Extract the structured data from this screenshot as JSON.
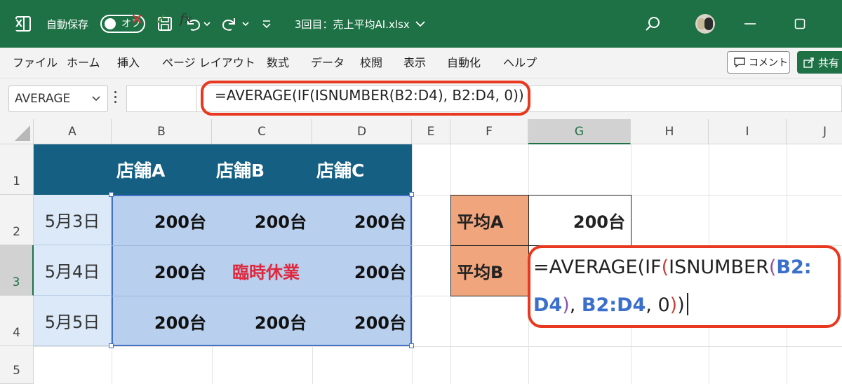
{
  "titlebar": {
    "autosave_label": "自動保存",
    "autosave_state": "オフ",
    "doc_title": "3回目：売上平均AI.xlsx",
    "icons": [
      "excel-logo-icon",
      "save-icon",
      "undo-icon",
      "redo-icon",
      "customize-qat-icon",
      "search-icon",
      "minimize-icon",
      "maximize-icon"
    ],
    "accent_color": "#1e7145"
  },
  "menu": {
    "items": [
      "ファイル",
      "ホーム",
      "挿入",
      "ページ レイアウト",
      "数式",
      "データ",
      "校閲",
      "表示",
      "自動化",
      "ヘルプ"
    ],
    "comment_label": "コメント",
    "share_label": "共有"
  },
  "formula_bar": {
    "name_box": "AVERAGE",
    "fx_label": "fx",
    "formula": "=AVERAGE(IF(ISNUMBER(B2:D4), B2:D4, 0))",
    "highlight_color": "#e8381f"
  },
  "sheet": {
    "columns": [
      "A",
      "B",
      "C",
      "D",
      "E",
      "F",
      "G",
      "H",
      "I",
      "J"
    ],
    "rows": [
      "1",
      "2",
      "3",
      "4",
      "5"
    ],
    "selected_column": "G",
    "selected_row": "3",
    "header_row": [
      "店舗A",
      "店舗B",
      "店舗C"
    ],
    "header_color": "#155f83",
    "data_rows": [
      {
        "date": "5月3日",
        "values": [
          "200台",
          "200台",
          "200台"
        ]
      },
      {
        "date": "5月4日",
        "values": [
          "200台",
          "臨時休業",
          "200台"
        ]
      },
      {
        "date": "5月5日",
        "values": [
          "200台",
          "200台",
          "200台"
        ]
      }
    ],
    "averages": [
      {
        "label": "平均A",
        "value": "200台"
      },
      {
        "label": "平均B",
        "value": ""
      }
    ],
    "editing": {
      "line1_a": "=AVERAGE(IF",
      "line1_b": "(",
      "line1_c": "ISNUMBER",
      "line1_d": "(",
      "line1_e": "B2:",
      "line2_a": "D4",
      "line2_b": ")",
      "line2_c": ", ",
      "line2_d": "B2:D4",
      "line2_e": ", 0",
      "line2_f": ")",
      "line2_g": ")"
    }
  }
}
